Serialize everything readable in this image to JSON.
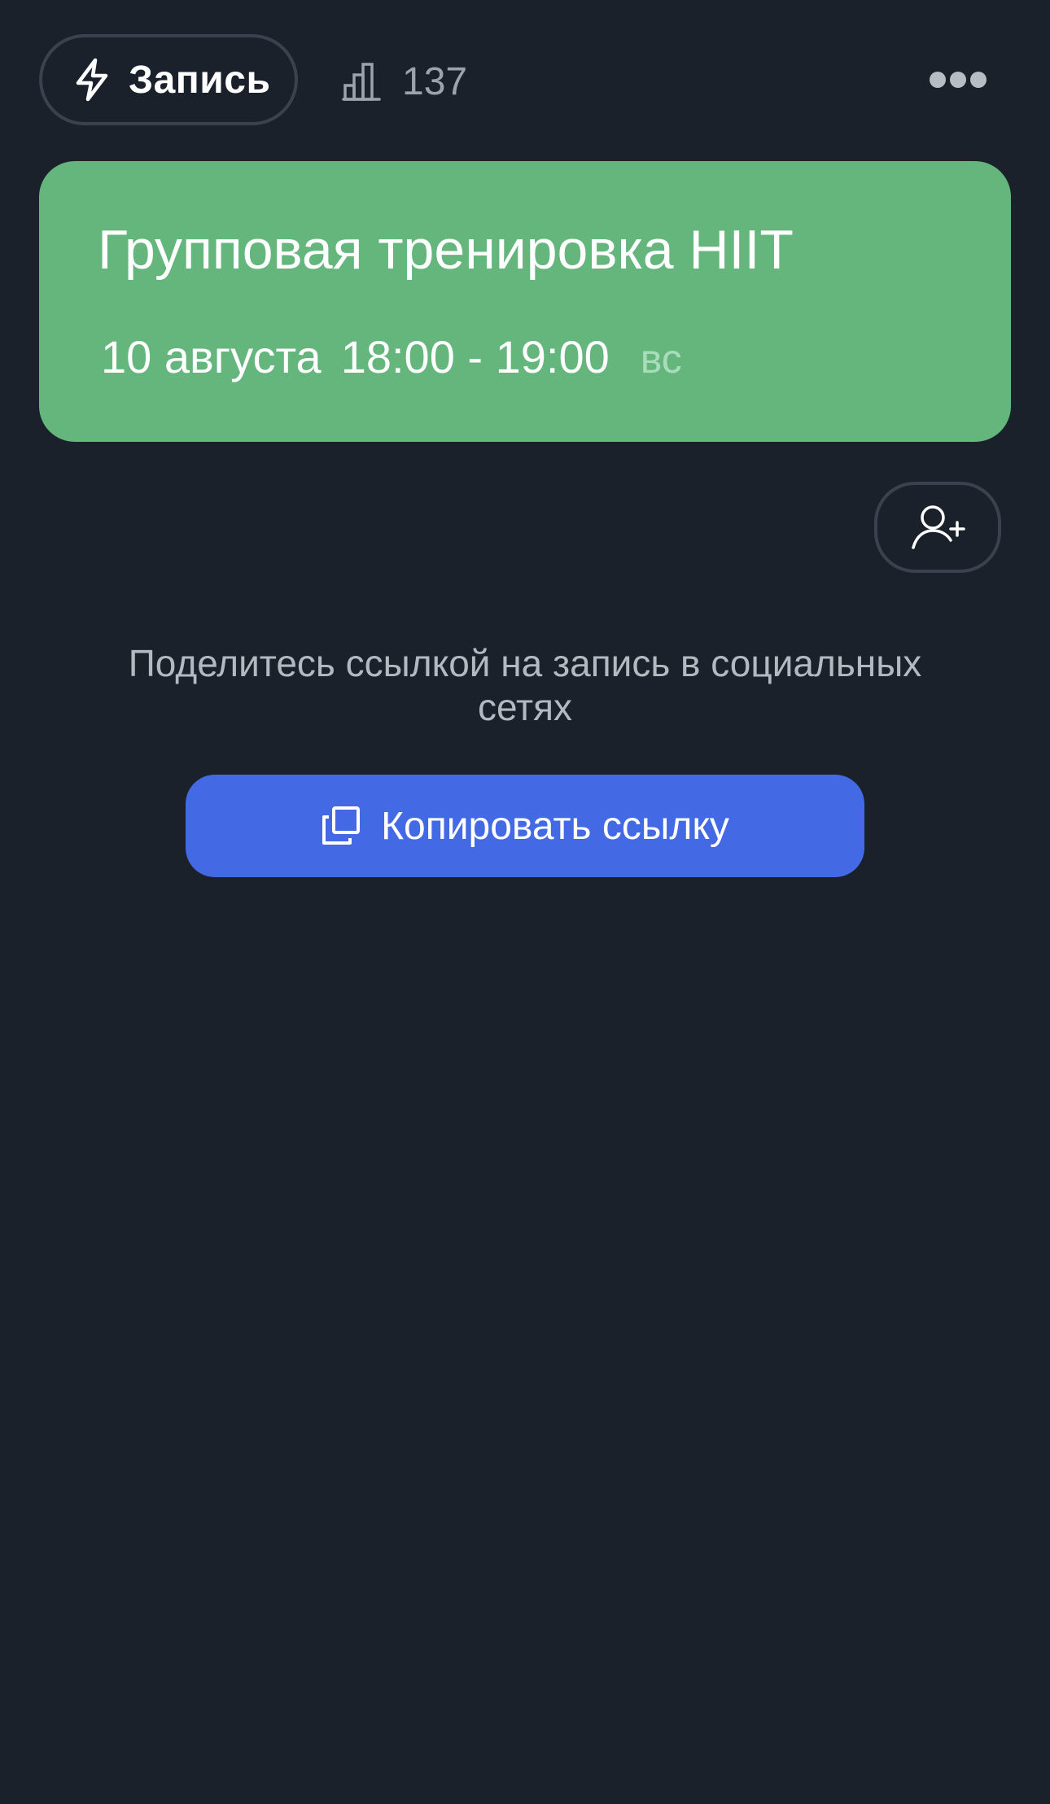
{
  "header": {
    "record_label": "Запись",
    "record_icon": "lightning-icon",
    "stats_icon": "bar-chart-icon",
    "stats_count": "137",
    "more_icon": "more-dots-icon"
  },
  "event": {
    "title": "Групповая тренировка HIIT",
    "date": "10 августа",
    "time": "18:00 - 19:00",
    "weekday": "вс",
    "card_color": "#64b67d"
  },
  "actions": {
    "add_user_icon": "add-user-icon",
    "share_text": "Поделитесь ссылкой на запись в социальных сетях",
    "copy_label": "Копировать ссылку",
    "copy_icon": "copy-icon",
    "copy_button_color": "#4469e4"
  },
  "theme": {
    "background": "#1a212b",
    "border": "#3b424d"
  }
}
